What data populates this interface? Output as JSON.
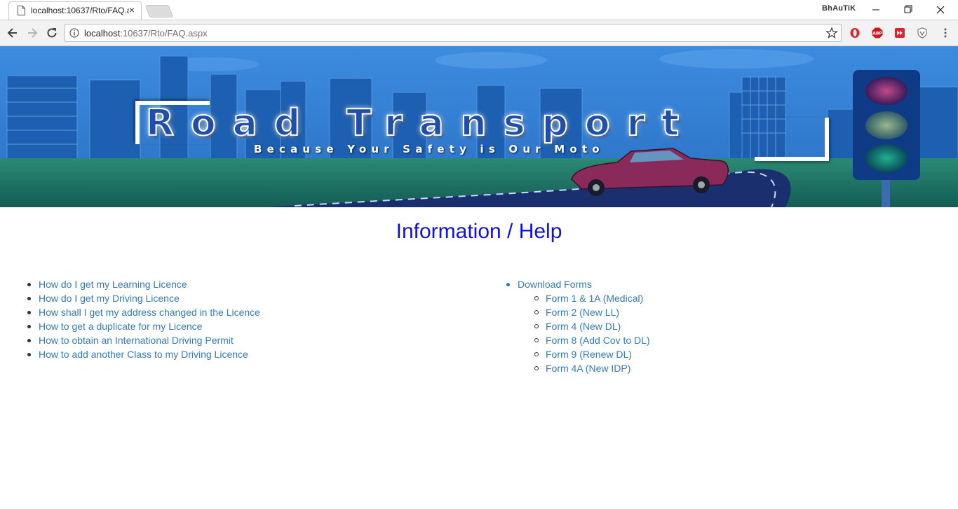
{
  "browser": {
    "tab_title": "localhost:10637/Rto/FAQ.aspx",
    "tab_close": "×",
    "profile_name": "BhAuTiK",
    "url_host": "localhost",
    "url_rest": ":10637/Rto/FAQ.aspx"
  },
  "banner": {
    "title": "Road Transport",
    "tagline": "Because Your Safety is Our Moto",
    "colors": {
      "sky": "#2e7bd0",
      "grass": "#1f7a6a",
      "road": "#1a2f6e"
    }
  },
  "page": {
    "title": "Information / Help",
    "faq_links": [
      "How do I get my Learning Licence",
      "How do I get my Driving Licence",
      "How shall I get my address changed in the Licence",
      "How to get a duplicate for my Licence",
      "How to obtain an International Driving Permit",
      "How to add another Class to my Driving Licence"
    ],
    "downloads": {
      "label": "Download Forms",
      "forms": [
        "Form 1 & 1A (Medical)",
        "Form 2 (New LL)",
        "Form 4 (New DL)",
        "Form 8 (Add Cov to DL)",
        "Form 9 (Renew DL)",
        "Form 4A (New IDP)"
      ]
    },
    "link_color": "#337ab7",
    "title_color": "#1010e0"
  }
}
